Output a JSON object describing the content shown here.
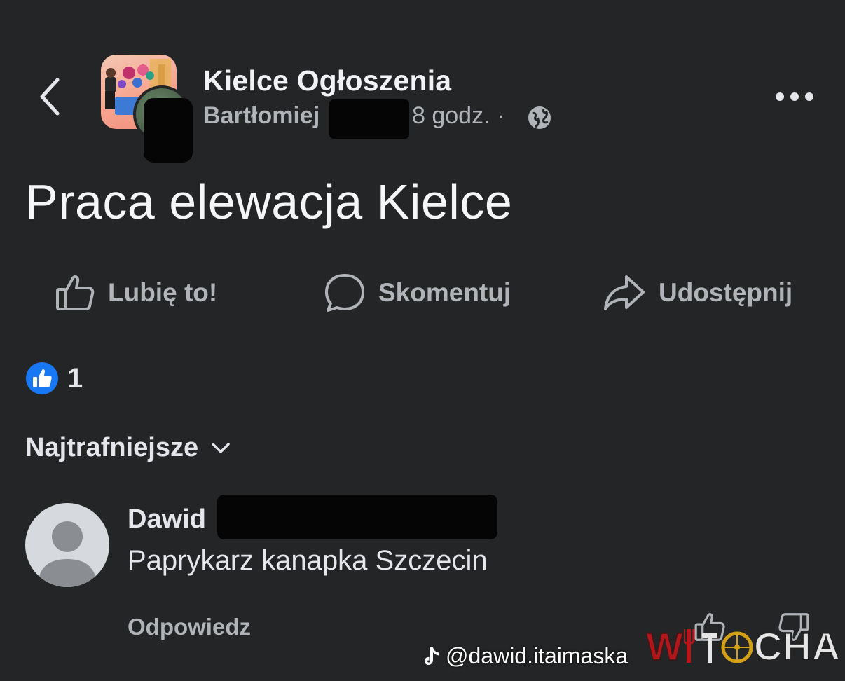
{
  "header": {
    "group_name": "Kielce Ogłoszenia",
    "author": "Bartłomiej",
    "time": "8 godz. ·"
  },
  "post": {
    "title": "Praca elewacja Kielce"
  },
  "actions": {
    "like_label": "Lubię to!",
    "comment_label": "Skomentuj",
    "share_label": "Udostępnij"
  },
  "reactions": {
    "count": "1"
  },
  "comments": {
    "sort_label": "Najtrafniejsze",
    "items": [
      {
        "author": "Dawid",
        "text": "Paprykarz kanapka Szczecin",
        "reply_label": "Odpowiedz"
      }
    ]
  },
  "overlay": {
    "tiktok_handle": "@dawid.itaimaska",
    "watermark_left": "W",
    "watermark_right": "CHA"
  },
  "colors": {
    "background": "#242526",
    "text_primary": "#e4e6eb",
    "text_secondary": "#b0b3b8",
    "like_blue": "#1877f2",
    "watermark_red": "#b5161b"
  },
  "icons": [
    "back-arrow-icon",
    "globe-icon",
    "more-icon",
    "thumbs-up-icon",
    "comment-bubble-icon",
    "share-arrow-icon",
    "like-reaction-icon",
    "chevron-down-icon",
    "default-avatar-icon",
    "thumbs-down-icon",
    "tiktok-icon"
  ]
}
